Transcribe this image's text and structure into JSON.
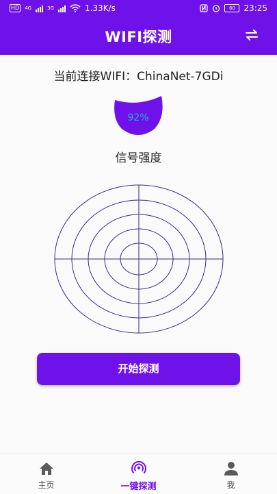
{
  "status_bar": {
    "hd": "HD",
    "net1": "4G",
    "net2": "3G",
    "speed": "1.33K/s",
    "battery": "60",
    "time": "23:25"
  },
  "header": {
    "title": "WIFI探测",
    "swap_icon": "swap-arrows-icon"
  },
  "connection": {
    "text": "当前连接WIFI：ChinaNet-7GDi"
  },
  "signal": {
    "percent_text": "92%",
    "level": 0.92,
    "label": "信号强度"
  },
  "colors": {
    "primary": "#6f12ea",
    "percent_text": "#1fb4c8",
    "radar_line": "#3d2a78"
  },
  "action": {
    "start_label": "开始探测"
  },
  "tabs": [
    {
      "label": "主页",
      "icon": "home-icon",
      "active": false
    },
    {
      "label": "一键探测",
      "icon": "wifi-radar-icon",
      "active": true
    },
    {
      "label": "我",
      "icon": "person-icon",
      "active": false
    }
  ]
}
